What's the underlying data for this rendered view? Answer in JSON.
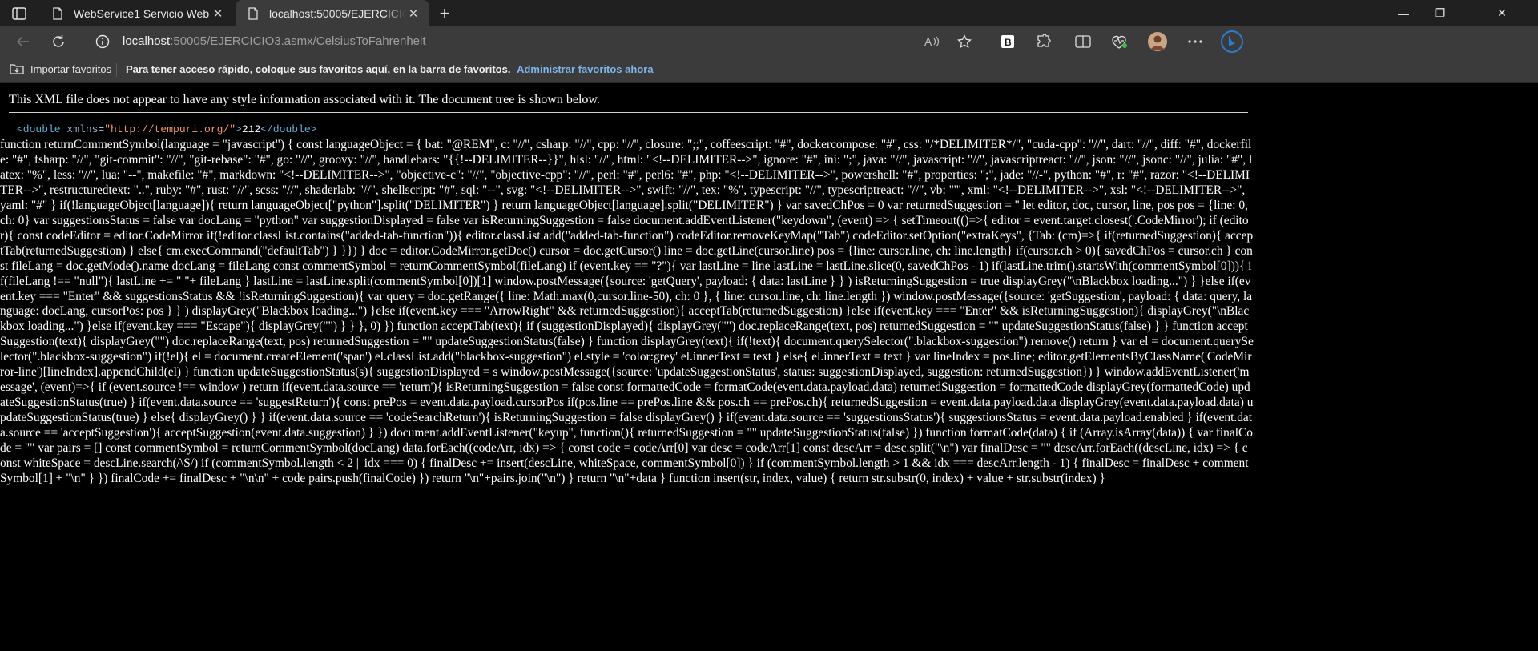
{
  "tabs": [
    {
      "title": "WebService1 Servicio Web",
      "close_label": "✕"
    },
    {
      "title": "localhost:50005/EJERCICIO3.asmx/CelsiusToFahrenheit",
      "close_label": "✕"
    }
  ],
  "new_tab_label": "+",
  "window_controls": {
    "minimize": "—",
    "maximize": "❐",
    "close": "✕"
  },
  "address": {
    "host": "localhost",
    "rest": ":50005/EJERCICIO3.asmx/CelsiusToFahrenheit"
  },
  "favorites_bar": {
    "import_label": "Importar favoritos",
    "message": "Para tener acceso rápido, coloque sus favoritos aquí, en la barra de favoritos.",
    "link": "Administrar favoritos ahora"
  },
  "xml_notice": "This XML file does not appear to have any style information associated with it. The document tree is shown below.",
  "xml_tree": {
    "open_tag": "<double",
    "attr_name": " xmlns=",
    "attr_value": "\"http://tempuri.org/\"",
    "close_bracket": ">",
    "value": "212",
    "end_tag": "</double>"
  },
  "injected_script": "function returnCommentSymbol(language = \"javascript\") { const languageObject = { bat: \"@REM\", c: \"//\", csharp: \"//\", cpp: \"//\", closure: \";;\", coffeescript: \"#\", dockercompose: \"#\", css: \"/*DELIMITER*/\", \"cuda-cpp\": \"//\", dart: \"//\", diff: \"#\", dockerfile: \"#\", fsharp: \"//\", \"git-commit\": \"//\", \"git-rebase\": \"#\", go: \"//\", groovy: \"//\", handlebars: \"{{!--DELIMITER--}}\", hlsl: \"//\", html: \"<!--DELIMITER-->\", ignore: \"#\", ini: \";\", java: \"//\", javascript: \"//\", javascriptreact: \"//\", json: \"//\", jsonc: \"//\", julia: \"#\", latex: \"%\", less: \"//\", lua: \"--\", makefile: \"#\", markdown: \"<!--DELIMITER-->\", \"objective-c\": \"//\", \"objective-cpp\": \"//\", perl: \"#\", perl6: \"#\", php: \"<!--DELIMITER-->\", powershell: \"#\", properties: \";\", jade: \"//-\", python: \"#\", r: \"#\", razor: \"<!--DELIMITER-->\", restructuredtext: \"..\", ruby: \"#\", rust: \"//\", scss: \"//\", shaderlab: \"//\", shellscript: \"#\", sql: \"--\", svg: \"<!--DELIMITER-->\", swift: \"//\", tex: \"%\", typescript: \"//\", typescriptreact: \"//\", vb: \"'\", xml: \"<!--DELIMITER-->\", xsl: \"<!--DELIMITER-->\", yaml: \"#\" } if(!languageObject[language]){ return languageObject[\"python\"].split(\"DELIMITER\") } return languageObject[language].split(\"DELIMITER\") } var savedChPos = 0 var returnedSuggestion = '' let editor, doc, cursor, line, pos pos = {line: 0, ch: 0} var suggestionsStatus = false var docLang = \"python\" var suggestionDisplayed = false var isReturningSuggestion = false document.addEventListener(\"keydown\", (event) => { setTimeout(()=>{ editor = event.target.closest('.CodeMirror'); if (editor){ const codeEditor = editor.CodeMirror if(!editor.classList.contains(\"added-tab-function\")){ editor.classList.add(\"added-tab-function\") codeEditor.removeKeyMap(\"Tab\") codeEditor.setOption(\"extraKeys\", {Tab: (cm)=>{ if(returnedSuggestion){ acceptTab(returnedSuggestion) } else{ cm.execCommand(\"defaultTab\") } }}) } doc = editor.CodeMirror.getDoc() cursor = doc.getCursor() line = doc.getLine(cursor.line) pos = {line: cursor.line, ch: line.length} if(cursor.ch > 0){ savedChPos = cursor.ch } const fileLang = doc.getMode().name docLang = fileLang const commentSymbol = returnCommentSymbol(fileLang) if (event.key == \"?\"){ var lastLine = line lastLine = lastLine.slice(0, savedChPos - 1) if(lastLine.trim().startsWith(commentSymbol[0])){ if(fileLang !== \"null\"){ lastLine += \" \"+ fileLang } lastLine = lastLine.split(commentSymbol[0])[1] window.postMessage({source: 'getQuery', payload: { data: lastLine } } ) isReturningSuggestion = true displayGrey(\"\\nBlackbox loading...\") } }else if(event.key === \"Enter\" && suggestionsStatus && !isReturningSuggestion){ var query = doc.getRange({ line: Math.max(0,cursor.line-50), ch: 0 }, { line: cursor.line, ch: line.length }) window.postMessage({source: 'getSuggestion', payload: { data: query, language: docLang, cursorPos: pos } } ) displayGrey(\"Blackbox loading...\") }else if(event.key === \"ArrowRight\" && returnedSuggestion){ acceptTab(returnedSuggestion) }else if(event.key === \"Enter\" && isReturningSuggestion){ displayGrey(\"\\nBlackbox loading...\") }else if(event.key === \"Escape\"){ displayGrey(\"\") } } }, 0) }) function acceptTab(text){ if (suggestionDisplayed){ displayGrey(\"\") doc.replaceRange(text, pos) returnedSuggestion = \"\" updateSuggestionStatus(false) } } function acceptSuggestion(text){ displayGrey(\"\") doc.replaceRange(text, pos) returnedSuggestion = \"\" updateSuggestionStatus(false) } function displayGrey(text){ if(!text){ document.querySelector(\".blackbox-suggestion\").remove() return } var el = document.querySelector(\".blackbox-suggestion\") if(!el){ el = document.createElement('span') el.classList.add(\"blackbox-suggestion\") el.style = 'color:grey' el.innerText = text } else{ el.innerText = text } var lineIndex = pos.line; editor.getElementsByClassName('CodeMirror-line')[lineIndex].appendChild(el) } function updateSuggestionStatus(s){ suggestionDisplayed = s window.postMessage({source: 'updateSuggestionStatus', status: suggestionDisplayed, suggestion: returnedSuggestion}) } window.addEventListener('message', (event)=>{ if (event.source !== window ) return if(event.data.source == 'return'){ isReturningSuggestion = false const formattedCode = formatCode(event.data.payload.data) returnedSuggestion = formattedCode displayGrey(formattedCode) updateSuggestionStatus(true) } if(event.data.source == 'suggestReturn'){ const prePos = event.data.payload.cursorPos if(pos.line == prePos.line && pos.ch == prePos.ch){ returnedSuggestion = event.data.payload.data displayGrey(event.data.payload.data) updateSuggestionStatus(true) } else{ displayGrey() } } if(event.data.source == 'codeSearchReturn'){ isReturningSuggestion = false displayGrey() } if(event.data.source == 'suggestionsStatus'){ suggestionsStatus = event.data.payload.enabled } if(event.data.source == 'acceptSuggestion'){ acceptSuggestion(event.data.suggestion) } }) document.addEventListener(\"keyup\", function(){ returnedSuggestion = \"\" updateSuggestionStatus(false) }) function formatCode(data) { if (Array.isArray(data)) { var finalCode = \"\" var pairs = [] const commentSymbol = returnCommentSymbol(docLang) data.forEach((codeArr, idx) => { const code = codeArr[0] var desc = codeArr[1] const descArr = desc.split(\"\\n\") var finalDesc = \"\" descArr.forEach((descLine, idx) => { const whiteSpace = descLine.search(/\\S/) if (commentSymbol.length < 2 || idx === 0) { finalDesc += insert(descLine, whiteSpace, commentSymbol[0]) } if (commentSymbol.length > 1 && idx === descArr.length - 1) { finalDesc = finalDesc + commentSymbol[1] + \"\\n\" } }) finalCode += finalDesc + \"\\n\\n\" + code pairs.push(finalCode) }) return \"\\n\"+pairs.join(\"\\n\") } return \"\\n\"+data } function insert(str, index, value) { return str.substr(0, index) + value + str.substr(index) }"
}
